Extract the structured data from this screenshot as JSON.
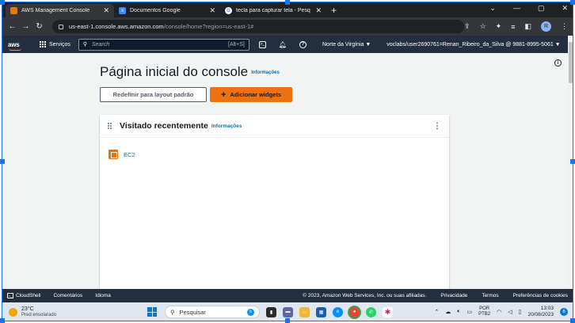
{
  "browser": {
    "tabs": [
      {
        "label": "AWS Management Console",
        "active": true,
        "icon": "aws-icon"
      },
      {
        "label": "Documentos Google",
        "active": false,
        "icon": "google-docs-icon"
      },
      {
        "label": "tecla para capturar tela - Pesquisa",
        "active": false,
        "icon": "google-icon"
      }
    ],
    "url_host": "us-east-1.console.aws.amazon.com",
    "url_path": "/console/home?region=us-east-1#",
    "profile_initial": "R"
  },
  "aws_nav": {
    "logo": "aws",
    "services_label": "Serviços",
    "search_placeholder": "Search",
    "search_shortcut": "[Alt+S]",
    "region": "Norte da Virgínia ▼",
    "account": "voclabs/user2690761=Renan_Ribeiro_da_Silva @ 9881-8995-5061 ▼"
  },
  "main": {
    "title": "Página inicial do console",
    "info_label": "Informações",
    "reset_button": "Redefinir para layout padrão",
    "add_widgets_button": "Adicionar widgets",
    "add_widgets_plus": "+"
  },
  "widget": {
    "title": "Visitado recentemente",
    "info_label": "Informações",
    "menu": "⋮",
    "items": [
      {
        "label": "EC2",
        "icon": "ec2-icon"
      }
    ]
  },
  "footer": {
    "cloudshell": "CloudShell",
    "comments": "Comentários",
    "language": "Idioma",
    "copyright": "© 2023, Amazon Web Services, Inc. ou suas afiliadas.",
    "privacy": "Privacidade",
    "terms": "Termos",
    "cookies": "Preferências de cookies"
  },
  "taskbar": {
    "temperature": "23°C",
    "weather": "Pred ensolarado",
    "search_placeholder": "Pesquisar",
    "lang_top": "POR",
    "lang_bottom": "PTB2",
    "time": "13:03",
    "date": "20/08/2023",
    "notifications": "6"
  },
  "colors": {
    "aws_nav": "#232f3e",
    "aws_orange": "#ec7211",
    "link": "#0073bb",
    "browser_dark": "#202124"
  }
}
